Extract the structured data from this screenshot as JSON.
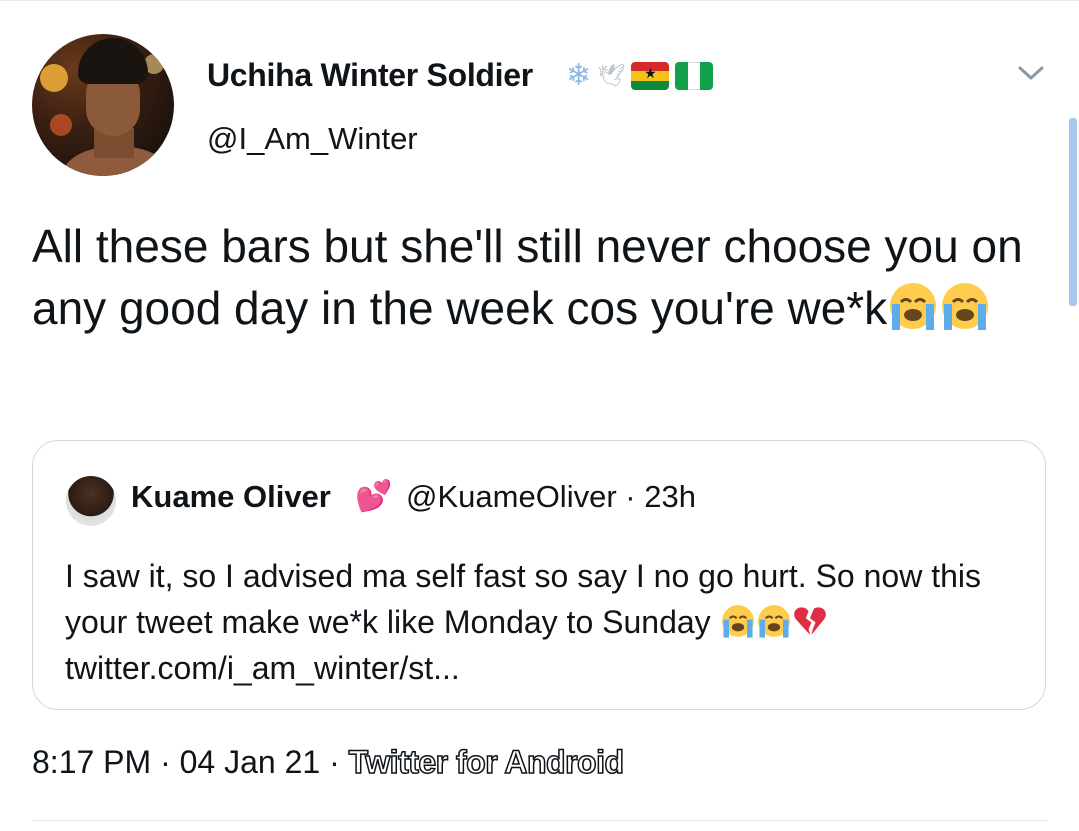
{
  "tweet": {
    "author": {
      "display_name": "Uchiha Winter Soldier",
      "handle": "@I_Am_Winter",
      "badges": [
        "snowflake-icon",
        "dove-icon",
        "ghana-flag",
        "nigeria-flag"
      ]
    },
    "text": "All these bars but she'll still never choose you on any good day in the week cos you're we*k",
    "emojis": [
      "loudly-crying-face",
      "loudly-crying-face"
    ],
    "timestamp": "8:17 PM",
    "date": "04 Jan 21",
    "source": "Twitter for Android",
    "separator": "·"
  },
  "quote": {
    "display_name": "Kuame Oliver",
    "handle": "@KuameOliver",
    "age": "23h",
    "separator": "·",
    "text": "I saw it, so I advised ma self fast so say I no go hurt. So now this your tweet make we*k like Monday to Sunday",
    "emojis": [
      "loudly-crying-face",
      "loudly-crying-face",
      "broken-heart"
    ],
    "link": "twitter.com/i_am_winter/st..."
  },
  "colors": {
    "text": "#0f1419",
    "border": "#cfd9de",
    "heart": "#e8305a",
    "scrollbar": "#a8c7ec"
  }
}
